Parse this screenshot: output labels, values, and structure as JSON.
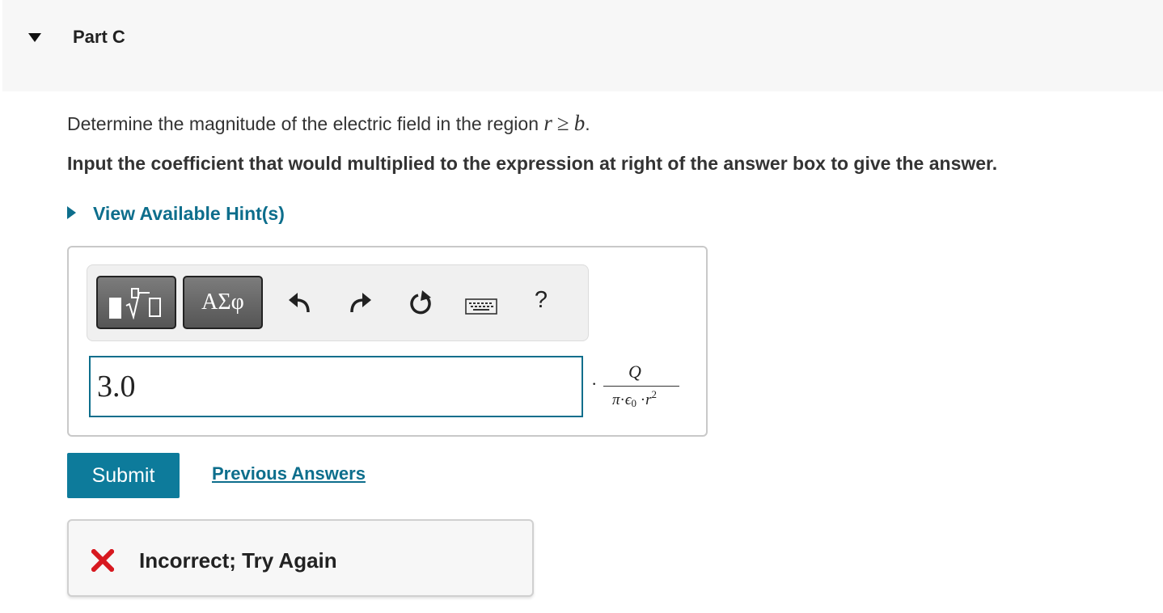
{
  "part": {
    "title": "Part C",
    "caret_icon": "caret-down-icon"
  },
  "question": {
    "text": "Determine the magnitude of the electric field in the region",
    "math_var": "r",
    "math_op": "≥",
    "math_bound": "b",
    "end_punct": "."
  },
  "instruction": "Input the coefficient that would multiplied to the expression at right of the answer box to give the answer.",
  "hint": {
    "label": "View Available Hint(s)",
    "icon": "caret-right-icon"
  },
  "toolbar": {
    "template_button_icon": "templates-icon",
    "greek_label": "ΑΣφ",
    "undo_icon": "undo-icon",
    "redo_icon": "redo-icon",
    "reset_icon": "reset-icon",
    "keyboard_icon": "keyboard-icon",
    "help_label": "?"
  },
  "answer": {
    "value": "3.0",
    "expression": {
      "multiplier": "·",
      "numerator": "Q",
      "denominator": {
        "pi": "π",
        "dot": "·",
        "epsilon": "ϵ",
        "epsilon_sub": "0",
        "r": "r",
        "r_exp": "2"
      }
    }
  },
  "actions": {
    "submit_label": "Submit",
    "previous_answers_label": "Previous Answers"
  },
  "feedback": {
    "icon": "x-icon",
    "text": "Incorrect; Try Again",
    "icon_color": "#d71920"
  },
  "colors": {
    "accent": "#0d6e8c",
    "submit_bg": "#0d7b9b",
    "header_bg": "#f7f7f7"
  }
}
